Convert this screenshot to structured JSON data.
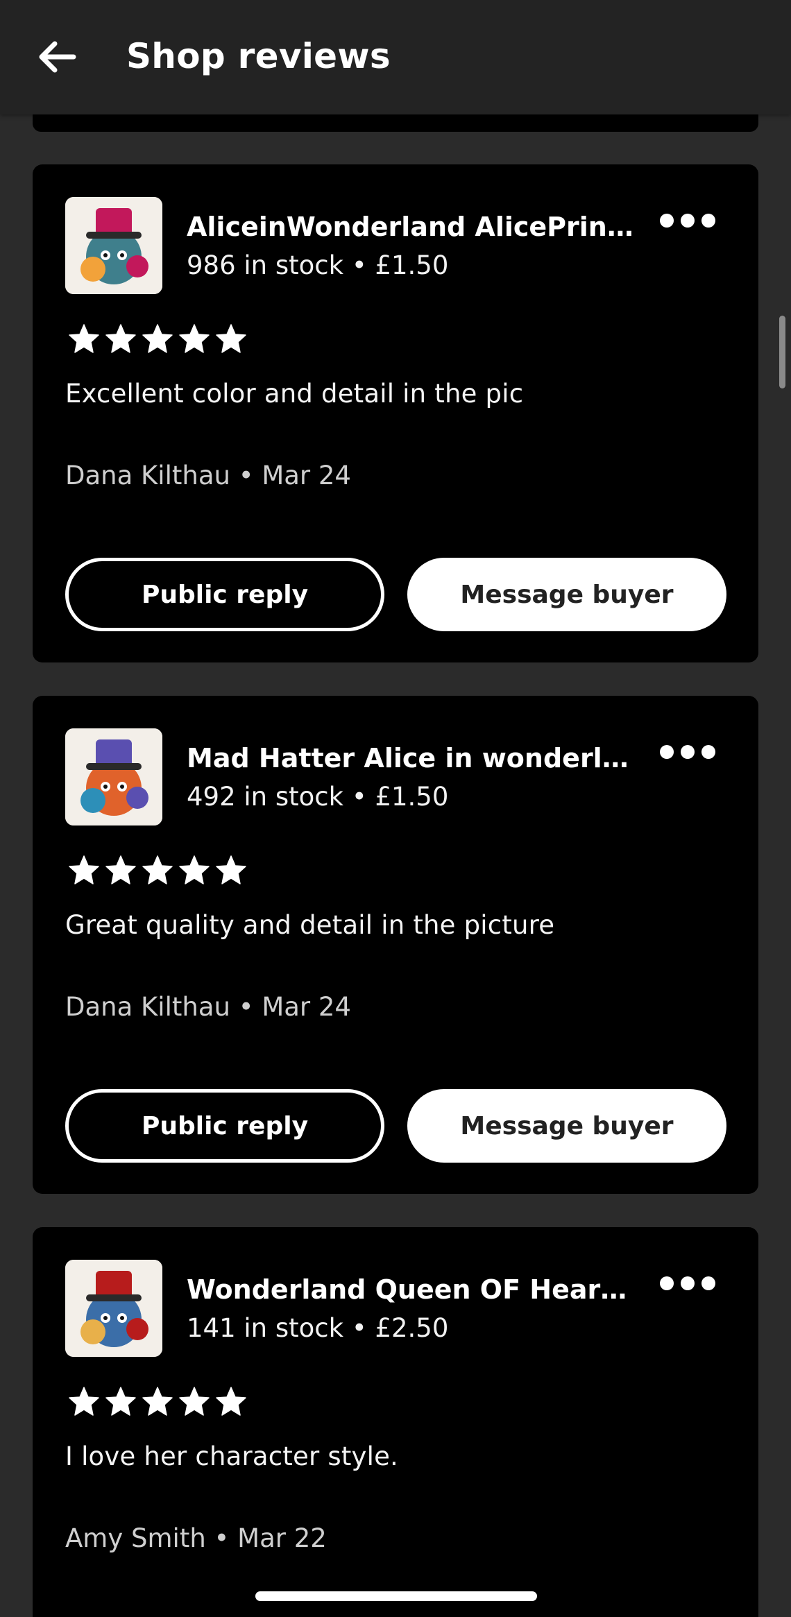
{
  "header": {
    "back_icon": "arrow-left-icon",
    "title": "Shop reviews"
  },
  "reviews": [
    {
      "product_title": "AliceinWonderland AlicePrints ...",
      "stock": "986 in stock",
      "price": "£1.50",
      "rating": 5,
      "text": "Excellent color and detail in the pic",
      "author": "Dana Kilthau",
      "date": "Mar 24",
      "reply_label": "Public reply",
      "message_label": "Message buyer",
      "thumb_colors": [
        "#c2185b",
        "#3f7f8c",
        "#f2a23a"
      ]
    },
    {
      "product_title": "Mad Hatter Alice in wonderland ...",
      "stock": "492 in stock",
      "price": "£1.50",
      "rating": 5,
      "text": "Great quality and detail in the picture",
      "author": "Dana Kilthau",
      "date": "Mar 24",
      "reply_label": "Public reply",
      "message_label": "Message buyer",
      "thumb_colors": [
        "#5a4fb0",
        "#e0622b",
        "#2d8fb8"
      ]
    },
    {
      "product_title": "Wonderland Queen OF Hearts , ...",
      "stock": "141 in stock",
      "price": "£2.50",
      "rating": 5,
      "text": "I love her character style.",
      "author": "Amy Smith",
      "date": "Mar 22",
      "reply_label": "Public reply",
      "message_label": "Message buyer",
      "thumb_colors": [
        "#b71c1c",
        "#3b6ea8",
        "#e8b04a"
      ]
    }
  ],
  "separator": "•",
  "colors": {
    "background": "#2b2b2b",
    "card": "#000000",
    "header": "#232323",
    "text": "#ffffff"
  }
}
